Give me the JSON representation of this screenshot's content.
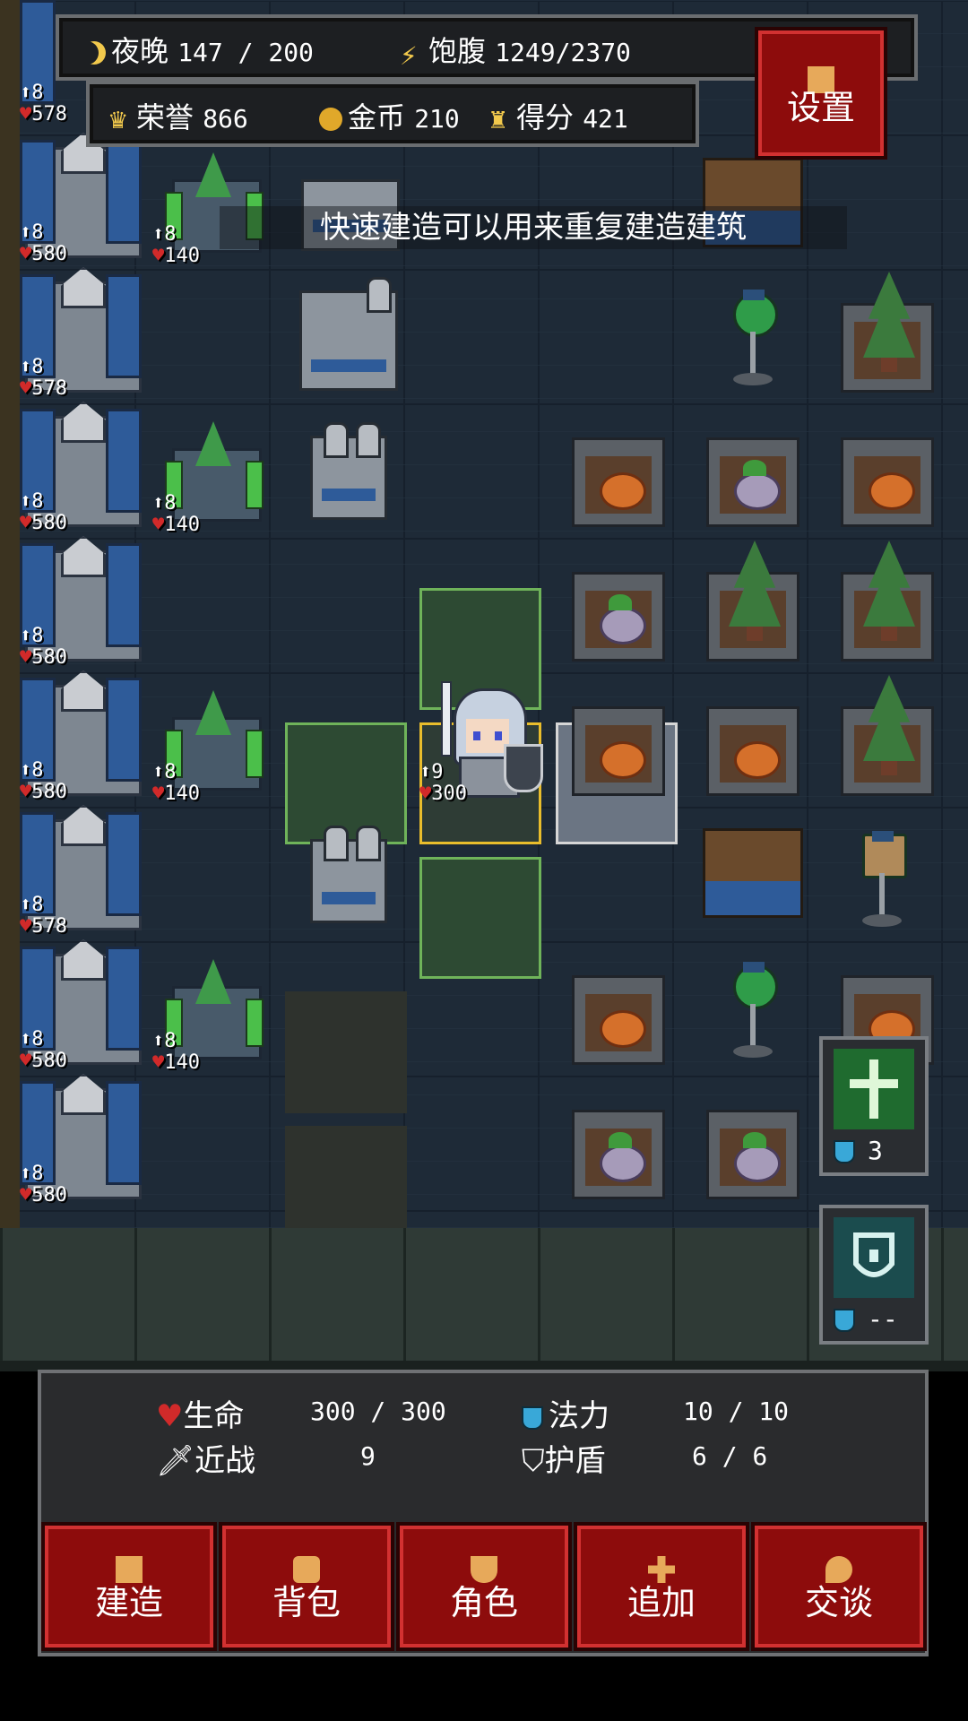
{
  "hud": {
    "night_label": "夜晚",
    "night_value": "147 / 200",
    "satiety_label": "饱腹",
    "satiety_value": "1249/2370",
    "honor_label": "荣誉",
    "honor_value": "866",
    "gold_label": "金币",
    "gold_value": "210",
    "score_label": "得分",
    "score_value": "421",
    "settings_label": "设置"
  },
  "toast": "快速建造可以用来重复建造建筑",
  "walls": [
    {
      "atk": "8",
      "hp": "578"
    },
    {
      "atk": "8",
      "hp": "580"
    },
    {
      "atk": "8",
      "hp": "578"
    },
    {
      "atk": "8",
      "hp": "580"
    },
    {
      "atk": "8",
      "hp": "580"
    },
    {
      "atk": "8",
      "hp": "580"
    },
    {
      "atk": "8",
      "hp": "578"
    },
    {
      "atk": "8",
      "hp": "580"
    },
    {
      "atk": "8",
      "hp": "580"
    }
  ],
  "towers": [
    {
      "atk": "8",
      "hp": "140"
    },
    {
      "atk": "8",
      "hp": "140"
    },
    {
      "atk": "8",
      "hp": "140"
    },
    {
      "atk": "8",
      "hp": "140"
    }
  ],
  "hero": {
    "atk": "9",
    "hp": "300"
  },
  "skills": [
    {
      "icon": "holy-cross-icon",
      "cost": "3"
    },
    {
      "icon": "shield-rune-icon",
      "cost": "--"
    }
  ],
  "stats": {
    "hp_label": "生命",
    "hp_value": "300 / 300",
    "mp_label": "法力",
    "mp_value": "10 / 10",
    "melee_label": "近战",
    "melee_value": "9",
    "shield_label": "护盾",
    "shield_value": "6 / 6"
  },
  "actions": [
    {
      "label": "建造",
      "icon": "hammer-icon"
    },
    {
      "label": "背包",
      "icon": "bag-icon"
    },
    {
      "label": "角色",
      "icon": "character-icon"
    },
    {
      "label": "追加",
      "icon": "plus-icon"
    },
    {
      "label": "交谈",
      "icon": "chat-icon"
    }
  ],
  "colors": {
    "accent_red": "#8d0c0c",
    "select_gold": "#e9bd2c",
    "tile_green": "#6fb35a"
  }
}
